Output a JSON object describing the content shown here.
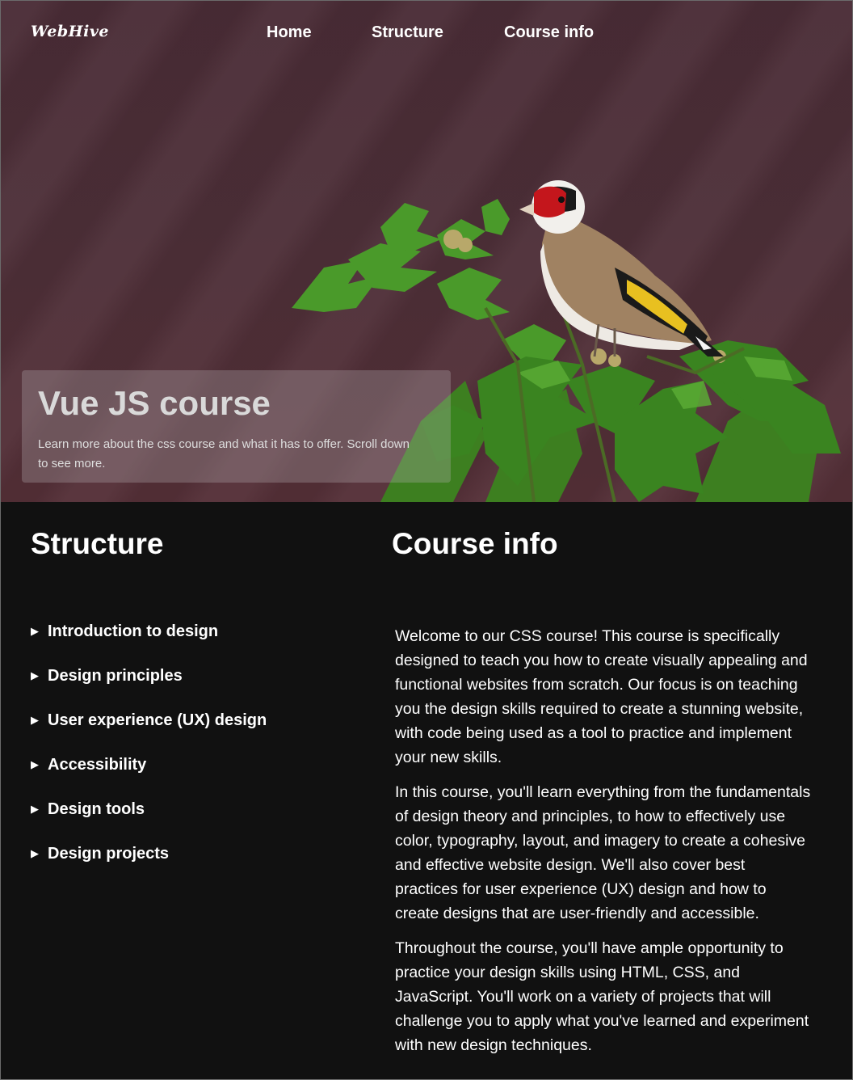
{
  "header": {
    "logo": "WebHive",
    "nav": [
      "Home",
      "Structure",
      "Course info"
    ]
  },
  "hero": {
    "title": "Vue JS course",
    "subtitle": "Learn more about the css course and what it has to offer. Scroll down to see more."
  },
  "structure": {
    "title": "Structure",
    "items": [
      "Introduction to design",
      "Design principles",
      "User experience (UX) design",
      "Accessibility",
      "Design tools",
      "Design projects"
    ]
  },
  "course_info": {
    "title": "Course info",
    "paragraphs": [
      "Welcome to our CSS course! This course is specifically designed to teach you how to create visually appealing and functional websites from scratch. Our focus is on teaching you the design skills required to create a stunning website, with code being used as a tool to practice and implement your new skills.",
      "In this course, you'll learn everything from the fundamentals of design theory and principles, to how to effectively use color, typography, layout, and imagery to create a cohesive and effective website design. We'll also cover best practices for user experience (UX) design and how to create designs that are user-friendly and accessible.",
      "Throughout the course, you'll have ample opportunity to practice your design skills using HTML, CSS, and JavaScript. You'll work on a variety of projects that will challenge you to apply what you've learned and experiment with new design techniques."
    ]
  },
  "colors": {
    "hero_background": "#4d2f38",
    "page_background": "#111111",
    "text": "#ffffff",
    "leaf_green": "#3f8a22",
    "bird_red": "#c4161c",
    "wing_yellow": "#e8c020"
  }
}
